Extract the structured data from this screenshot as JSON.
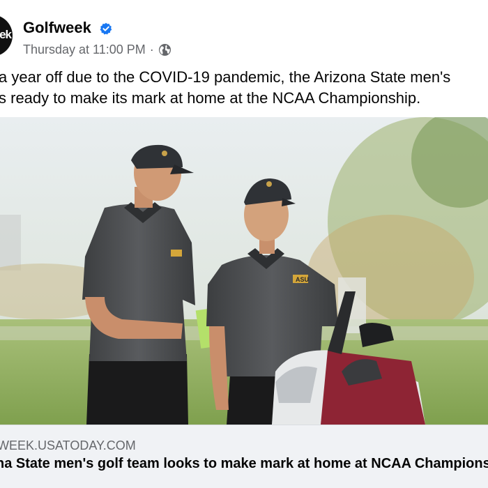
{
  "post": {
    "page_name": "Golfweek",
    "avatar_text": "ek",
    "timestamp": "Thursday at 11:00 PM",
    "separator": "·",
    "audience_icon": "globe-icon",
    "verified_icon": "verified-badge-icon",
    "caption_lines": [
      "a year off due to the COVID-19 pandemic, the Arizona State men's",
      "s ready to make its mark at home at the NCAA Championship."
    ],
    "photo_label": "ASU",
    "link_preview": {
      "domain": "WEEK.USATODAY.COM",
      "headline": "na State men's golf team looks to make mark at home at NCAA Championship"
    }
  },
  "colors": {
    "verified_blue": "#1877f2",
    "secondary_text": "#65676b",
    "link_box_bg": "#f0f2f5"
  }
}
